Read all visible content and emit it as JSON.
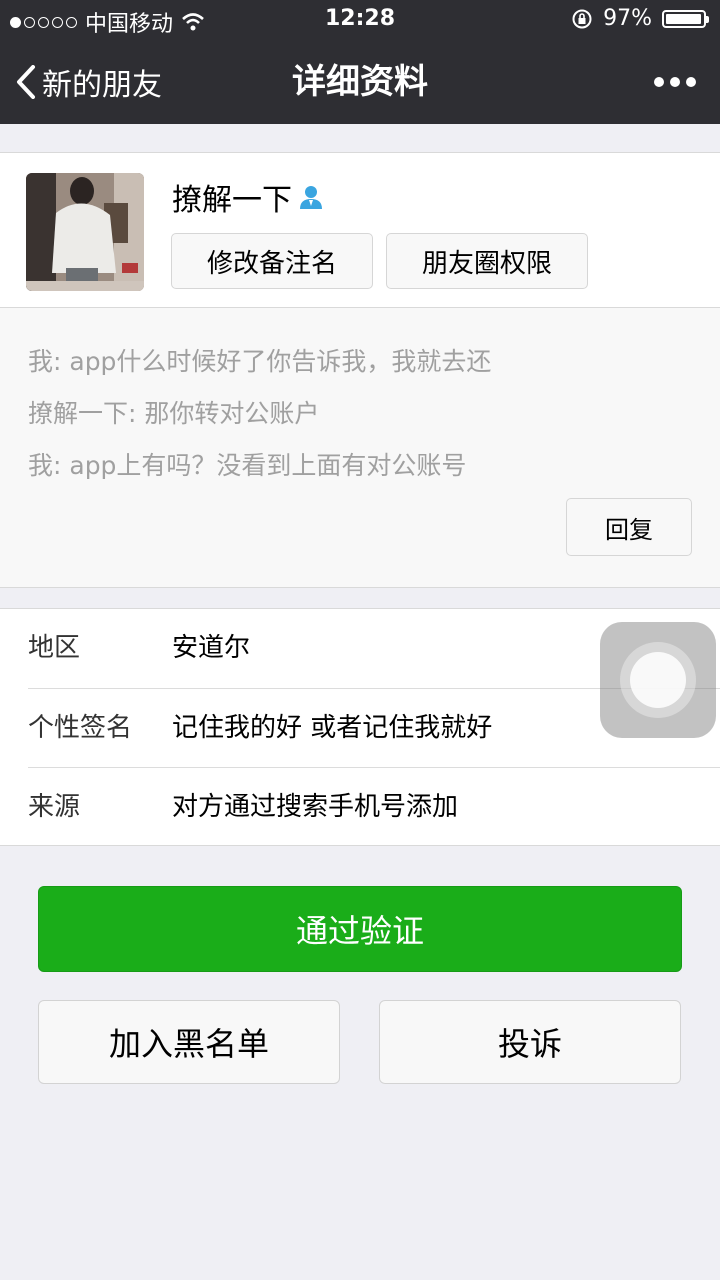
{
  "status_bar": {
    "carrier": "中国移动",
    "time": "12:28",
    "battery": "97%",
    "battery_level": 0.97,
    "signal_bars": 1,
    "icons": [
      "signal-dots-icon",
      "wifi-icon",
      "rotation-lock-icon",
      "battery-icon"
    ]
  },
  "nav": {
    "back_label": "新的朋友",
    "title": "详细资料",
    "icons": [
      "chevron-left-icon",
      "more-icon"
    ]
  },
  "profile": {
    "name": "撩解一下",
    "remark_button": "修改备注名",
    "moments_button": "朋友圈权限",
    "icons": [
      "contact-person-icon"
    ]
  },
  "messages": {
    "lines": [
      "我: app什么时候好了你告诉我，我就去还",
      "撩解一下: 那你转对公账户",
      "我: app上有吗？没看到上面有对公账号"
    ],
    "reply_button": "回复"
  },
  "info": {
    "rows": [
      {
        "label": "地区",
        "value": "安道尔"
      },
      {
        "label": "个性签名",
        "value": "记住我的好 或者记住我就好"
      },
      {
        "label": "来源",
        "value": "对方通过搜索手机号添加"
      }
    ]
  },
  "actions": {
    "verify": "通过验证",
    "blacklist": "加入黑名单",
    "report": "投诉"
  },
  "colors": {
    "nav_bg": "#2e2e33",
    "accent_green": "#1aad19",
    "page_bg": "#efeff4"
  }
}
